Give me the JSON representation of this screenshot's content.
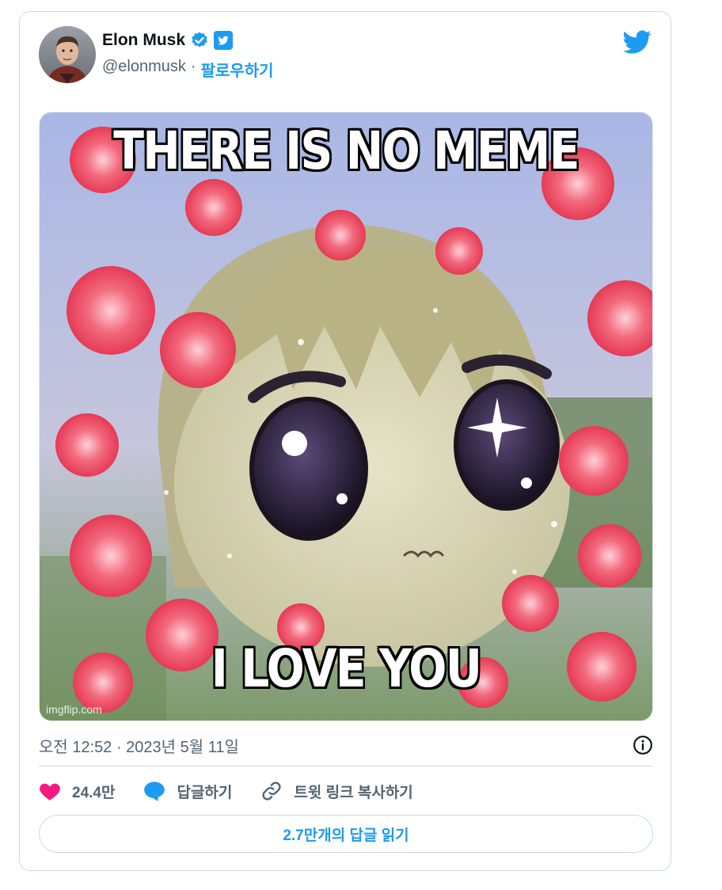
{
  "author": {
    "name": "Elon Musk",
    "handle": "@elonmusk",
    "separator": "·",
    "follow_label": "팔로우하기"
  },
  "media": {
    "top_text": "THERE IS NO MEME",
    "bottom_text": "I LOVE YOU",
    "watermark": "imgflip.com"
  },
  "meta": {
    "timestamp": "오전 12:52 · 2023년 5월 11일"
  },
  "actions": {
    "likes": "24.4만",
    "reply_label": "답글하기",
    "copy_link_label": "트윗 링크 복사하기"
  },
  "read_replies_label": "2.7만개의 답글 읽기",
  "colors": {
    "accent": "#1d9bf0",
    "like": "#f91880",
    "text_secondary": "#536471"
  },
  "icons": [
    "verified-badge-icon",
    "twitter-badge-icon",
    "twitter-logo-icon",
    "info-icon",
    "heart-icon",
    "reply-bubble-icon",
    "link-icon"
  ]
}
